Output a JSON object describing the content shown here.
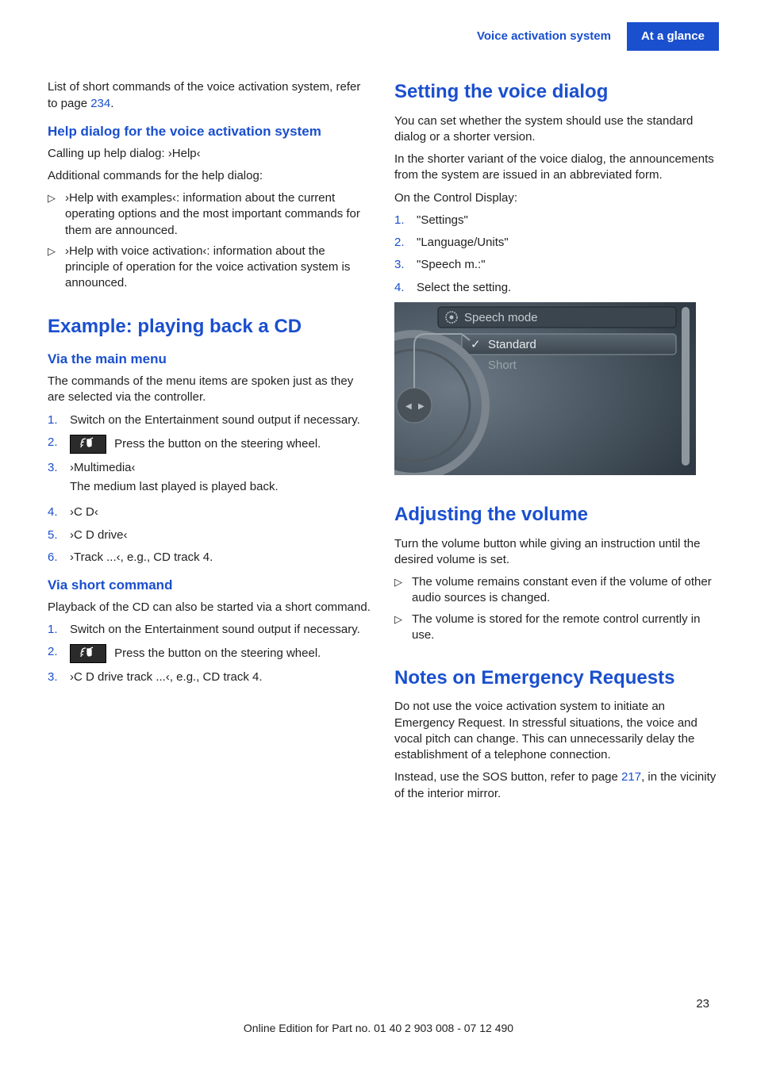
{
  "header": {
    "section": "Voice activation system",
    "chapter": "At a glance"
  },
  "left": {
    "intro_pre": "List of short commands of the voice activation system, refer to page ",
    "intro_link": "234",
    "intro_post": ".",
    "h_help": "Help dialog for the voice activation system",
    "help_p1": "Calling up help dialog: ›Help‹",
    "help_p2": "Additional commands for the help dialog:",
    "help_items": [
      "›Help with examples‹: information about the current operating options and the most important commands for them are announced.",
      "›Help with voice activation‹: information about the principle of operation for the voice activation system is announced."
    ],
    "h_example": "Example: playing back a CD",
    "h_via_main": "Via the main menu",
    "via_main_p": "The commands of the menu items are spoken just as they are selected via the controller.",
    "main_steps": [
      {
        "n": "1.",
        "body": "Switch on the Entertainment sound output if necessary."
      },
      {
        "n": "2.",
        "icon": true,
        "body": "Press the button on the steering wheel."
      },
      {
        "n": "3.",
        "body": "›Multimedia‹",
        "sub": "The medium last played is played back."
      },
      {
        "n": "4.",
        "body": "›C D‹"
      },
      {
        "n": "5.",
        "body": "›C D drive‹"
      },
      {
        "n": "6.",
        "body": "›Track ...‹, e.g., CD track 4."
      }
    ],
    "h_via_short": "Via short command",
    "via_short_p": "Playback of the CD can also be started via a short command.",
    "short_steps": [
      {
        "n": "1.",
        "body": "Switch on the Entertainment sound output if necessary."
      },
      {
        "n": "2.",
        "icon": true,
        "body": "Press the button on the steering wheel."
      },
      {
        "n": "3.",
        "body": "›C D drive track ...‹, e.g., CD track 4."
      }
    ]
  },
  "right": {
    "h_setting": "Setting the voice dialog",
    "setting_p1": "You can set whether the system should use the standard dialog or a shorter version.",
    "setting_p2": "In the shorter variant of the voice dialog, the announcements from the system are issued in an abbreviated form.",
    "setting_p3": "On the Control Display:",
    "setting_steps": [
      {
        "n": "1.",
        "body": "\"Settings\""
      },
      {
        "n": "2.",
        "body": "\"Language/Units\""
      },
      {
        "n": "3.",
        "body": "\"Speech m.:\""
      },
      {
        "n": "4.",
        "body": "Select the setting."
      }
    ],
    "screenshot": {
      "title": "Speech mode",
      "opt1": "Standard",
      "opt2": "Short"
    },
    "h_volume": "Adjusting the volume",
    "volume_p": "Turn the volume button while giving an instruction until the desired volume is set.",
    "volume_items": [
      "The volume remains constant even if the volume of other audio sources is changed.",
      "The volume is stored for the remote control currently in use."
    ],
    "h_notes": "Notes on Emergency Requests",
    "notes_p1": "Do not use the voice activation system to initiate an Emergency Request. In stressful situations, the voice and vocal pitch can change. This can unnecessarily delay the establishment of a telephone connection.",
    "notes_p2_pre": "Instead, use the SOS button, refer to page ",
    "notes_p2_link": "217",
    "notes_p2_post": ", in the vicinity of the interior mirror."
  },
  "footer": {
    "line": "Online Edition for Part no. 01 40 2 903 008 - 07 12 490",
    "page": "23"
  }
}
